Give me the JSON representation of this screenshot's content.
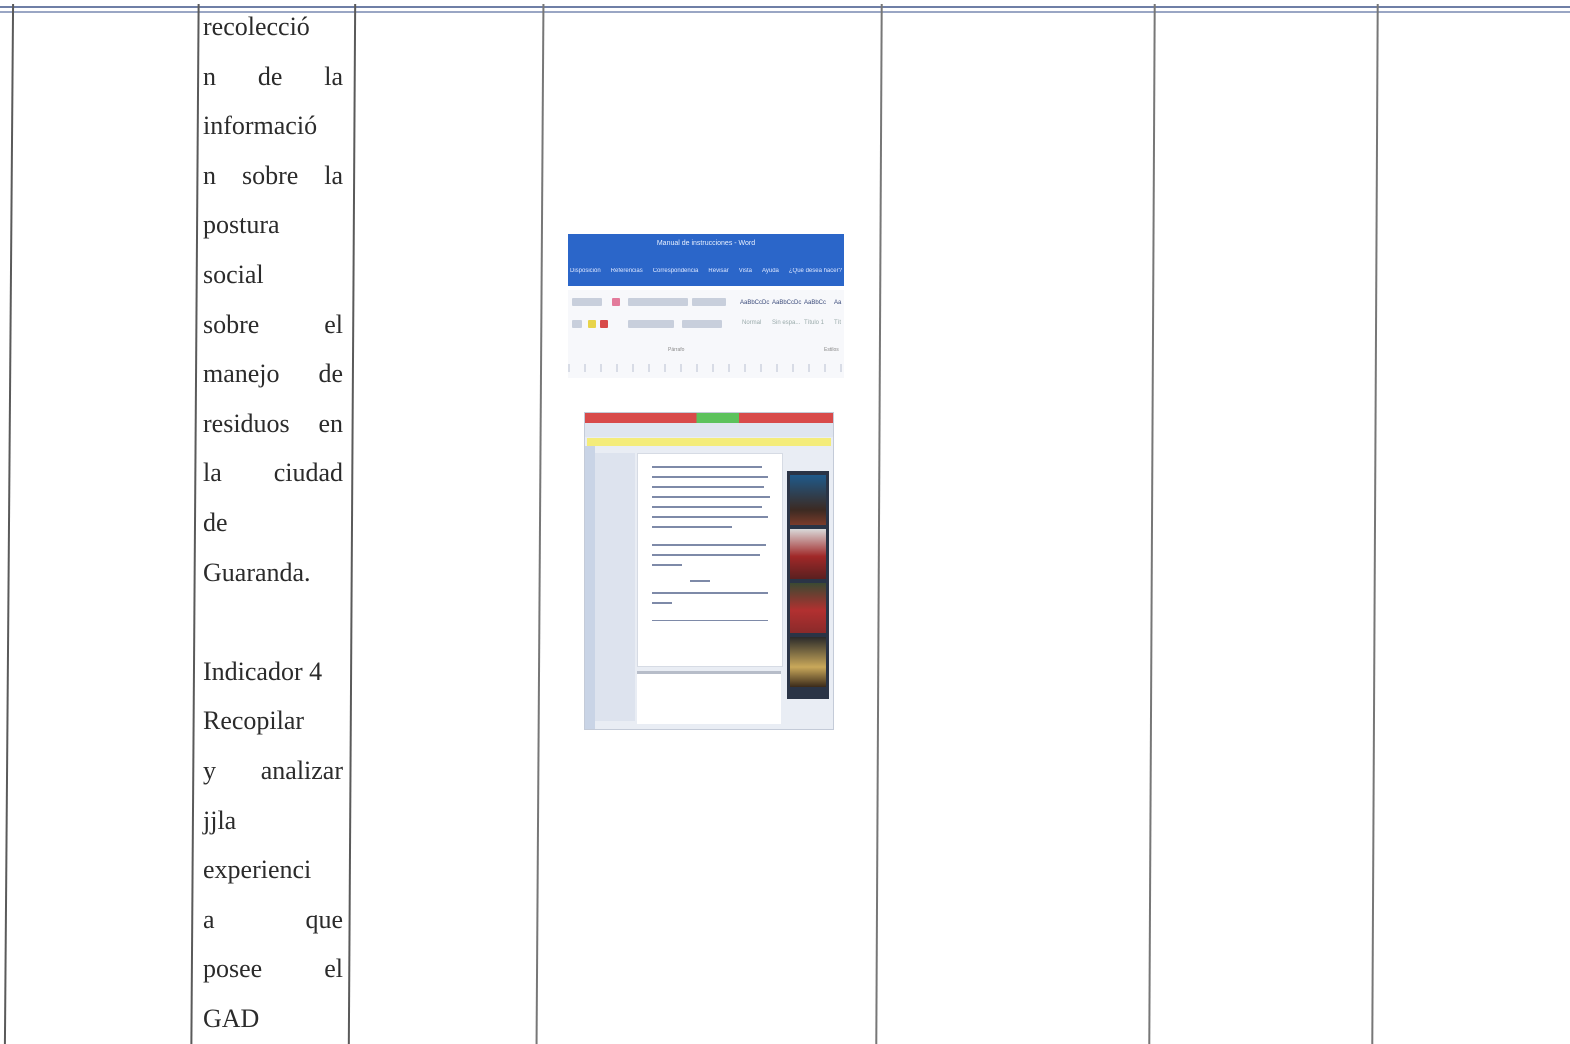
{
  "text_cell": {
    "lines": [
      "recolecció",
      "n de la",
      "informació",
      "n sobre la",
      "postura",
      "social",
      "sobre el",
      "manejo de",
      "residuos en",
      "la ciudad",
      "de",
      "Guaranda.",
      "",
      "Indicador 4",
      "Recopilar",
      "y analizar",
      "jjla",
      "experienci",
      "a que",
      "posee el",
      "GAD"
    ]
  },
  "screenshot": {
    "icon": "word-document-screenshot",
    "window_title": "Manual de instrucciones - Word",
    "ribbon_tabs": [
      "Disposición",
      "Referencias",
      "Correspondencia",
      "Revisar",
      "Vista",
      "Ayuda",
      "¿Qué desea hacer?"
    ],
    "styles": [
      "AaBbCcDc",
      "AaBbCcDc",
      "AaBbCc",
      "Aa"
    ],
    "style_names": [
      "Normal",
      "Sin espa...",
      "Título 1",
      "Tít"
    ],
    "group_labels": [
      "Párrafo",
      "Estilos"
    ],
    "colors": {
      "title_bar": "#2b66c9",
      "alert_bar": "#f4ec7a",
      "recording_bar_red": "#d84a4a",
      "recording_bar_green": "#5cc25c"
    }
  }
}
